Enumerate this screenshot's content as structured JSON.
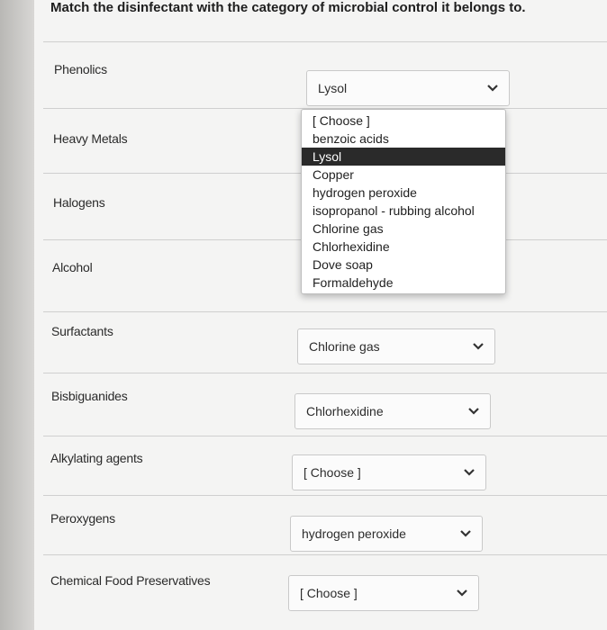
{
  "question": {
    "text": "Match the disinfectant with the category of microbial control it belongs to."
  },
  "rows": [
    {
      "label": "Phenolics",
      "selected": "Lysol"
    },
    {
      "label": "Heavy Metals",
      "selected": ""
    },
    {
      "label": "Halogens",
      "selected": ""
    },
    {
      "label": "Alcohol",
      "selected": ""
    },
    {
      "label": "Surfactants",
      "selected": "Chlorine gas"
    },
    {
      "label": "Bisbiguanides",
      "selected": "Chlorhexidine"
    },
    {
      "label": "Alkylating agents",
      "selected": "[ Choose ]"
    },
    {
      "label": "Peroxygens",
      "selected": "hydrogen peroxide"
    },
    {
      "label": "Chemical Food Preservatives",
      "selected": "[ Choose ]"
    }
  ],
  "dropdown": {
    "options": [
      "[ Choose ]",
      "benzoic acids",
      "Lysol",
      "Copper",
      "hydrogen peroxide",
      "isopropanol - rubbing alcohol",
      "Chlorine gas",
      "Chlorhexidine",
      "Dove soap",
      "Formaldehyde"
    ],
    "highlighted": "Lysol"
  },
  "icons": {
    "chevron": "chevron-down-icon"
  }
}
